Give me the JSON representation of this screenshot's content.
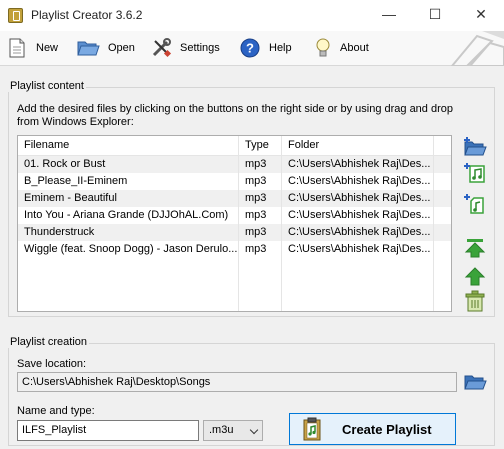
{
  "window": {
    "title": "Playlist Creator 3.6.2",
    "minimize": "—",
    "maximize": "☐",
    "close": "✕"
  },
  "toolbar": {
    "new_label": "New",
    "open_label": "Open",
    "settings_label": "Settings",
    "help_label": "Help",
    "about_label": "About"
  },
  "content": {
    "group_title": "Playlist content",
    "hint": "Add the desired files by clicking on the buttons on the right side or by using drag and drop from Windows Explorer:",
    "columns": [
      "Filename",
      "Type",
      "Folder"
    ],
    "rows": [
      {
        "filename": "01. Rock or Bust",
        "type": "mp3",
        "folder": "C:\\Users\\Abhishek Raj\\Des..."
      },
      {
        "filename": "B_Please_II-Eminem",
        "type": "mp3",
        "folder": "C:\\Users\\Abhishek Raj\\Des..."
      },
      {
        "filename": "Eminem - Beautiful",
        "type": "mp3",
        "folder": "C:\\Users\\Abhishek Raj\\Des..."
      },
      {
        "filename": "Into You - Ariana Grande (DJJOhAL.Com)",
        "type": "mp3",
        "folder": "C:\\Users\\Abhishek Raj\\Des..."
      },
      {
        "filename": "Thunderstruck",
        "type": "mp3",
        "folder": "C:\\Users\\Abhishek Raj\\Des..."
      },
      {
        "filename": "Wiggle (feat. Snoop Dogg) - Jason Derulo...",
        "type": "mp3",
        "folder": "C:\\Users\\Abhishek Raj\\Des..."
      }
    ],
    "side_buttons": [
      "add-folder-icon",
      "add-music-icon",
      "add-song-icon",
      "move-top-icon",
      "move-up-icon",
      "remove-icon"
    ]
  },
  "creation": {
    "group_title": "Playlist creation",
    "save_label": "Save location:",
    "save_path": "C:\\Users\\Abhishek Raj\\Desktop\\Songs",
    "name_label": "Name and type:",
    "name_value": "ILFS_Playlist",
    "type_value": ".m3u",
    "create_label": "Create Playlist"
  },
  "colors": {
    "accent": "#0078d7",
    "folder": "#3b72b8",
    "green": "#3aa33a",
    "button_bg": "#e5f1fb"
  }
}
